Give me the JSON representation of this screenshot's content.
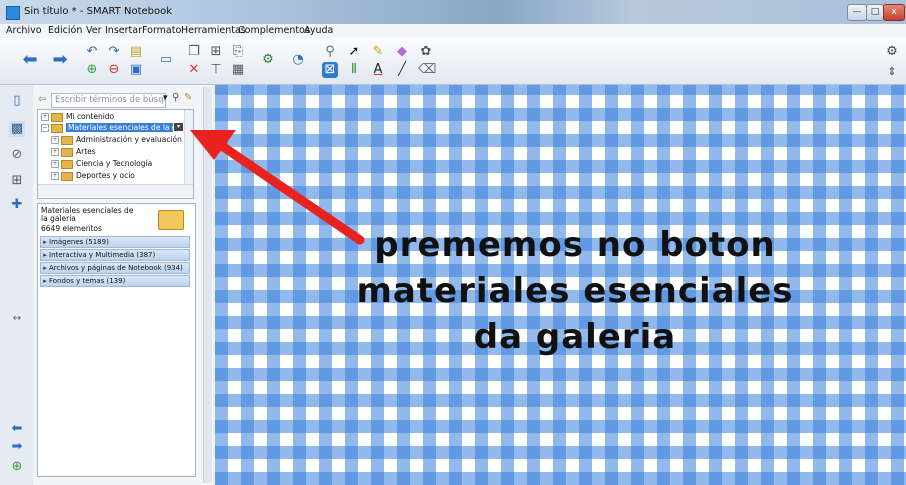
{
  "window": {
    "title": "Sin título * - SMART Notebook"
  },
  "window_controls": {
    "minimize": "—",
    "maximize": "□",
    "close": "x"
  },
  "menu": [
    "Archivo",
    "Edición",
    "Ver",
    "Insertar",
    "Formato",
    "Herramientas",
    "Complementos",
    "Ayuda"
  ],
  "gallery": {
    "search_placeholder": "Escribir términos de búsqu",
    "tree": [
      "Mi contenido",
      "Materiales esenciales de la galería",
      "Administración y evaluación",
      "Artes",
      "Ciencia y Tecnología",
      "Deportes y ocio"
    ],
    "details_title": "Materiales esenciales de la galería",
    "details_count": "6649 elementos",
    "categories": [
      "Imágenes (5189)",
      "Interactiva y Multimedia (387)",
      "Archivos y páginas de Notebook (934)",
      "Fondos y temas (139)"
    ]
  },
  "annotation": {
    "line1": "prememos no boton",
    "line2": "materiales esenciales",
    "line3": "da galeria"
  },
  "colors": {
    "arrow": "#e8231f",
    "check": "#3a7fd6",
    "selection": "#3a7fd6"
  },
  "icons": [
    "back-arrow-icon",
    "forward-arrow-icon",
    "undo-icon",
    "redo-icon",
    "open-icon",
    "save-icon",
    "select-icon",
    "pen-icon",
    "eraser-icon",
    "line-icon"
  ]
}
